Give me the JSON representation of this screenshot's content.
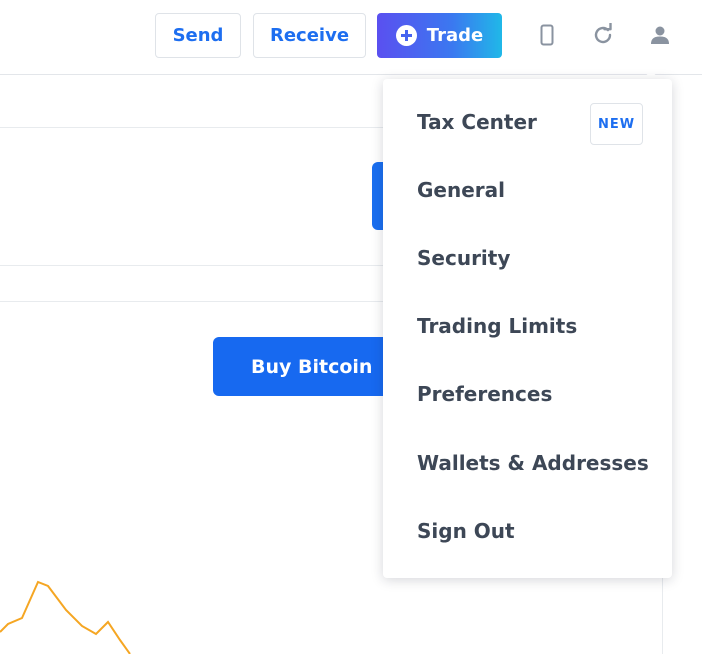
{
  "header": {
    "send_label": "Send",
    "receive_label": "Receive",
    "trade_label": "Trade",
    "icons": [
      "plus-circle-icon",
      "phone-icon",
      "refresh-icon",
      "user-icon"
    ]
  },
  "main": {
    "buy_button_label": "Buy Bitcoin"
  },
  "user_menu": {
    "items": [
      {
        "label": "Tax Center",
        "badge": "NEW"
      },
      {
        "label": "General"
      },
      {
        "label": "Security"
      },
      {
        "label": "Trading Limits"
      },
      {
        "label": "Preferences"
      },
      {
        "label": "Wallets & Addresses"
      },
      {
        "label": "Sign Out"
      }
    ]
  },
  "colors": {
    "accent_blue": "#1769f0",
    "trade_gradient_start": "#5a50f0",
    "trade_gradient_end": "#20b8e8",
    "chart_line": "#f5a623",
    "text_dark": "#3d4756"
  }
}
